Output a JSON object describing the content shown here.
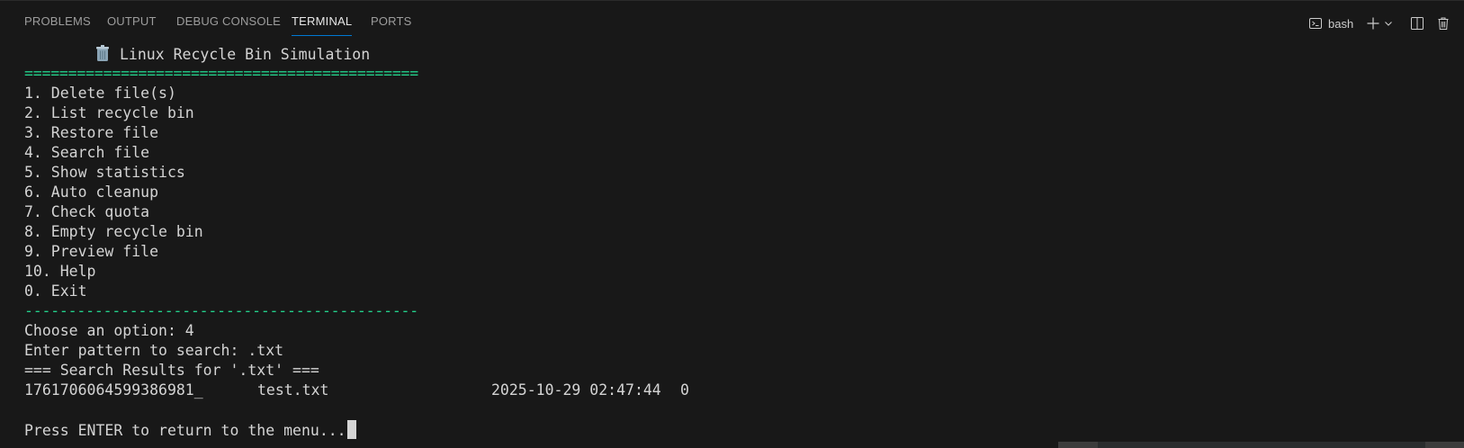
{
  "tabs": [
    {
      "label": "PROBLEMS",
      "active": false
    },
    {
      "label": "OUTPUT",
      "active": false
    },
    {
      "label": "DEBUG CONSOLE",
      "active": false
    },
    {
      "label": "TERMINAL",
      "active": true
    },
    {
      "label": "PORTS",
      "active": false
    }
  ],
  "actions": {
    "terminal_name": "bash",
    "icons": [
      "terminal-icon",
      "plus-icon",
      "chevron-down-icon",
      "split-icon",
      "trash-icon"
    ]
  },
  "terminal": {
    "title": "Linux Recycle Bin Simulation",
    "rule_double": "=============================================",
    "menu": [
      "1. Delete file(s)",
      "2. List recycle bin",
      "3. Restore file",
      "4. Search file",
      "5. Show statistics",
      "6. Auto cleanup",
      "7. Check quota",
      "8. Empty recycle bin",
      "9. Preview file",
      "10. Help",
      "0. Exit"
    ],
    "rule_dash": "---------------------------------------------",
    "prompt_option": "Choose an option: 4",
    "prompt_pattern": "Enter pattern to search: .txt",
    "results_header": "=== Search Results for '.txt' ===",
    "result_row": {
      "id": "1761706064599386981_",
      "name": "test.txt",
      "date": "2025-10-29 02:47:44",
      "size": "0"
    },
    "blank": "",
    "final_prompt": "Press ENTER to return to the menu..."
  },
  "colors": {
    "background": "#181818",
    "text": "#d4d4d4",
    "accent_rule": "#23d18b",
    "active_tab_border": "#0078d4"
  }
}
